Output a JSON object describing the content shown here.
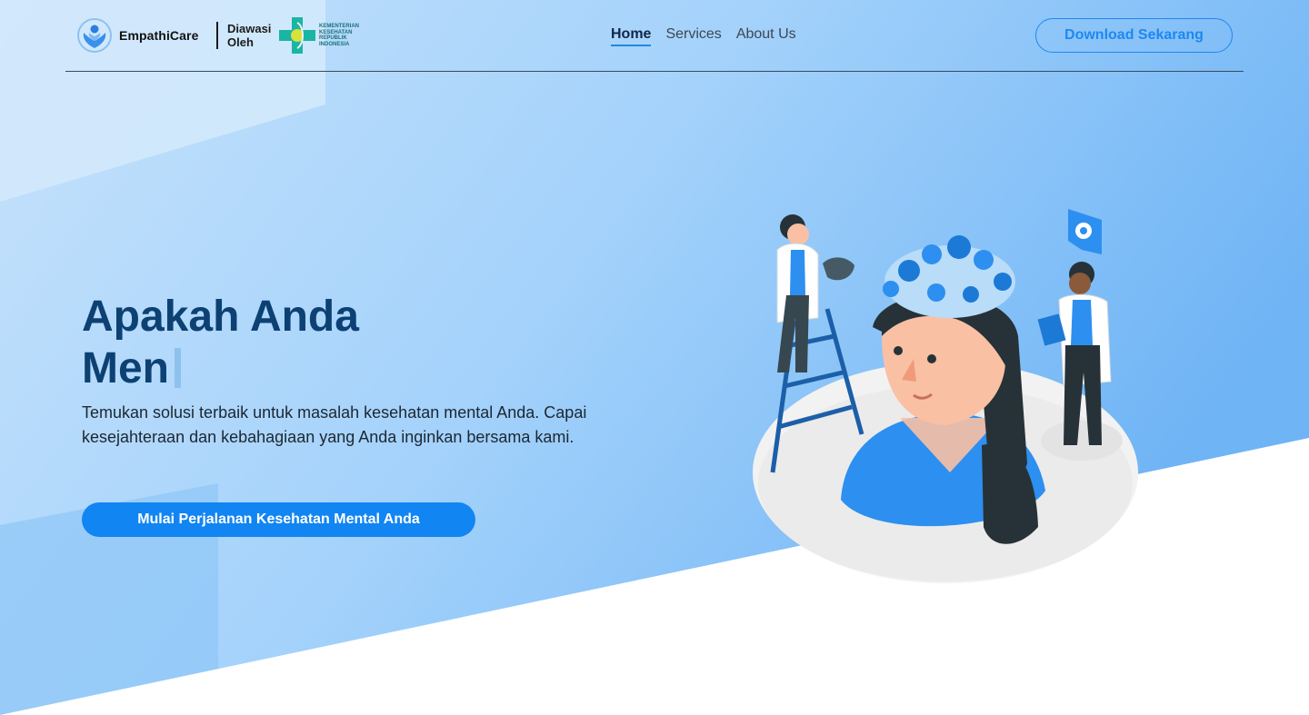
{
  "navbar": {
    "brand_name": "EmpathiCare",
    "supervised_label": "Diawasi Oleh",
    "partner_lines": [
      "KEMENTERIAN",
      "KESEHATAN",
      "REPUBLIK",
      "INDONESIA"
    ],
    "links": [
      {
        "label": "Home",
        "active": true
      },
      {
        "label": "Services",
        "active": false
      },
      {
        "label": "About Us",
        "active": false
      }
    ],
    "download_label": "Download Sekarang"
  },
  "hero": {
    "title_line1": "Apakah Anda",
    "title_line2": "Men",
    "description": "Temukan solusi terbaik untuk masalah kesehatan mental Anda. Capai kesejahteraan dan kebahagiaan yang Anda inginkan bersama kami.",
    "cta_label": "Mulai Perjalanan Kesehatan Mental Anda"
  },
  "colors": {
    "primary": "#1185f2",
    "title": "#0d4173",
    "background_light": "#cfe6fb",
    "background_mid": "#8cc6f8"
  },
  "icons": [
    "empathicare-logo",
    "kemenkes-logo",
    "gear-icon"
  ]
}
